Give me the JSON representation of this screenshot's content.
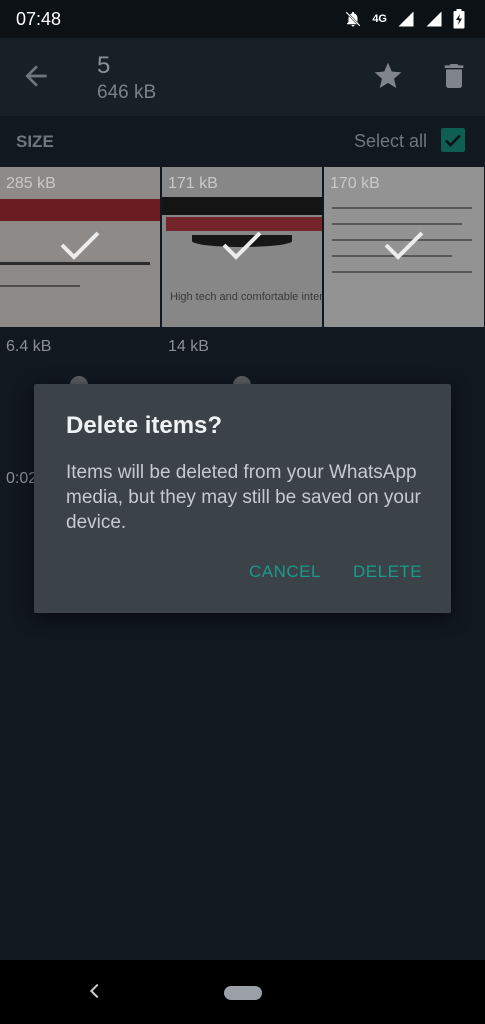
{
  "status_bar": {
    "time": "07:48",
    "network": "4G"
  },
  "app_bar": {
    "count": "5",
    "total_size": "646 kB"
  },
  "section": {
    "size_label": "SIZE",
    "select_all_label": "Select all",
    "select_all_checked": true
  },
  "media": [
    {
      "size": "285 kB",
      "selected": true
    },
    {
      "size": "171 kB",
      "selected": true,
      "caption": "High tech and comfortable inter"
    },
    {
      "size": "170 kB",
      "selected": true
    }
  ],
  "second_row_sizes": [
    "6.4 kB",
    "14 kB"
  ],
  "time_fragment": "0:02",
  "dialog": {
    "title": "Delete items?",
    "message": "Items will be deleted from your WhatsApp media, but they may still be saved on your device.",
    "cancel_label": "CANCEL",
    "delete_label": "DELETE"
  },
  "colors": {
    "accent": "#1a9a8a",
    "dialog_bg": "#3b4349",
    "background": "#111820"
  }
}
